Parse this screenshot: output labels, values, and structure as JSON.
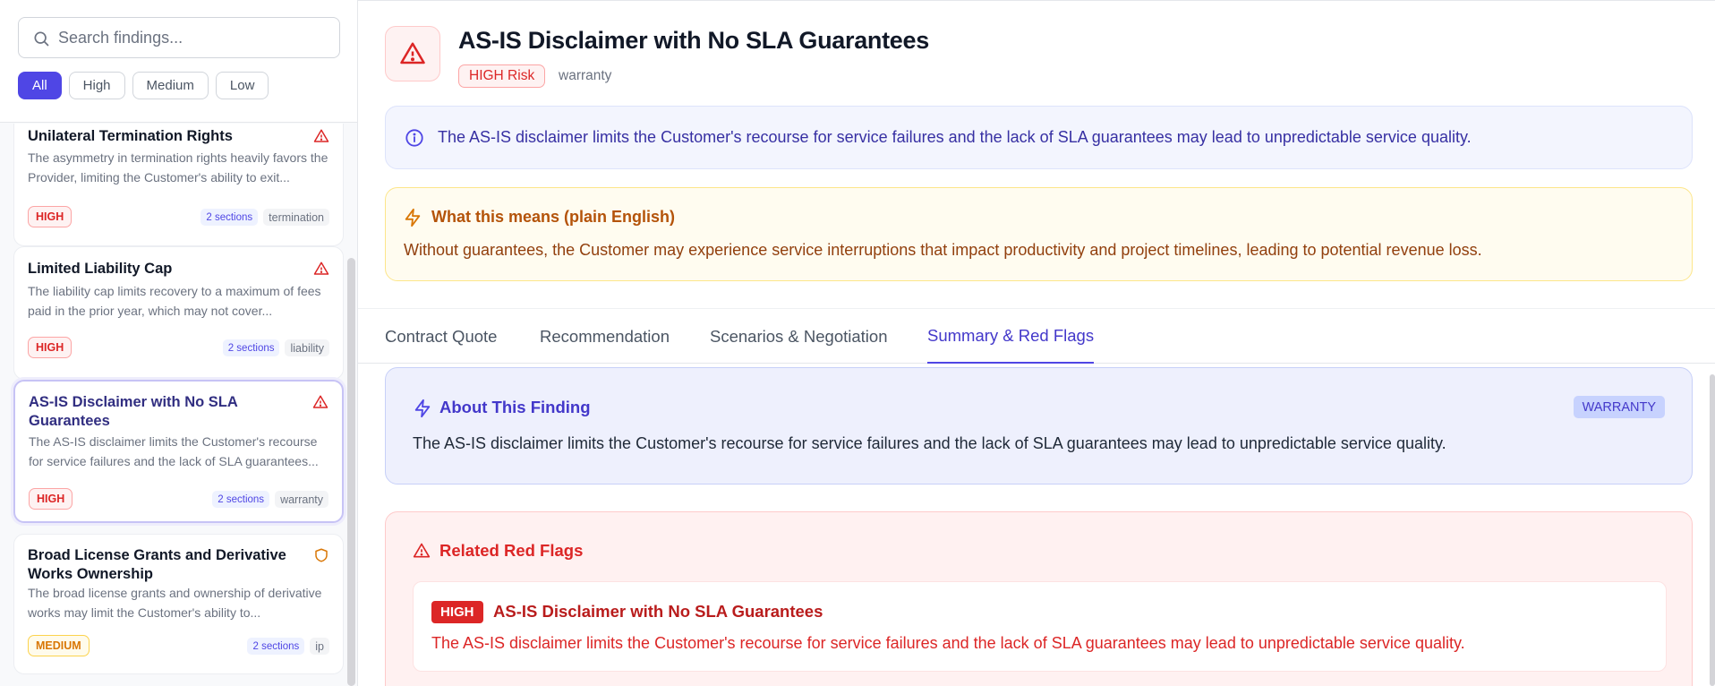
{
  "sidebar": {
    "search": {
      "placeholder": "Search findings..."
    },
    "filters": [
      "All",
      "High",
      "Medium",
      "Low"
    ],
    "cards": [
      {
        "title": "Unilateral Termination Rights",
        "description": "The asymmetry in termination rights heavily favors the Provider, limiting the Customer's ability to exit...",
        "risk": "HIGH",
        "sections": "2 sections",
        "category": "termination",
        "icon": "warning-triangle-icon"
      },
      {
        "title": "Limited Liability Cap",
        "description": "The liability cap limits recovery to a maximum of fees paid in the prior year, which may not cover...",
        "risk": "HIGH",
        "sections": "2 sections",
        "category": "liability",
        "icon": "warning-triangle-icon"
      },
      {
        "title": "AS-IS Disclaimer with No SLA Guarantees",
        "description": "The AS-IS disclaimer limits the Customer's recourse for service failures and the lack of SLA guarantees...",
        "risk": "HIGH",
        "sections": "2 sections",
        "category": "warranty",
        "icon": "warning-triangle-icon"
      },
      {
        "title": "Broad License Grants and Derivative Works Ownership",
        "description": "The broad license grants and ownership of derivative works may limit the Customer's ability to...",
        "risk": "MEDIUM",
        "sections": "2 sections",
        "category": "ip",
        "icon": "shield-icon"
      }
    ]
  },
  "finding": {
    "title": "AS-IS Disclaimer with No SLA Guarantees",
    "risk_badge": "HIGH Risk",
    "category": "warranty",
    "summary": "The AS-IS disclaimer limits the Customer's recourse for service failures and the lack of SLA guarantees may lead to unpredictable service quality.",
    "meaning_title": "What this means (plain English)",
    "meaning_text": "Without guarantees, the Customer may experience service interruptions that impact productivity and project timelines, leading to potential revenue loss."
  },
  "tabs": [
    "Contract Quote",
    "Recommendation",
    "Scenarios & Negotiation",
    "Summary & Red Flags"
  ],
  "active_tab": "Summary & Red Flags",
  "about": {
    "title": "About This Finding",
    "tag": "WARRANTY",
    "text": "The AS-IS disclaimer limits the Customer's recourse for service failures and the lack of SLA guarantees may lead to unpredictable service quality."
  },
  "red_flags": {
    "title": "Related Red Flags",
    "items": [
      {
        "badge": "HIGH",
        "title": "AS-IS Disclaimer with No SLA Guarantees",
        "text": "The AS-IS disclaimer limits the Customer's recourse for service failures and the lack of SLA guarantees may lead to unpredictable service quality."
      }
    ]
  },
  "colors": {
    "accent": "#4f46e5",
    "high": "#dc2626",
    "medium": "#d97706"
  }
}
